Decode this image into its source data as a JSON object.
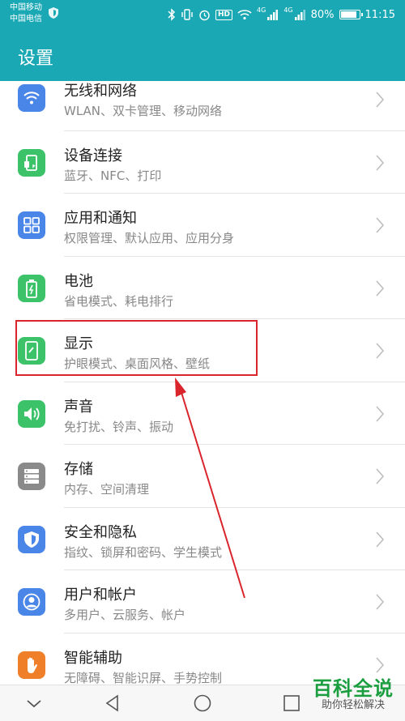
{
  "status_bar": {
    "carrier1": "中国移动",
    "carrier2": "中国电信",
    "battery": "80%",
    "time": "11:15",
    "hd_label": "HD",
    "network1": "4G",
    "network2": "4G"
  },
  "app_bar": {
    "title": "设置"
  },
  "settings": [
    {
      "title": "无线和网络",
      "subtitle": "WLAN、双卡管理、移动网络",
      "icon": "wifi-icon",
      "color": "#4a86e8"
    },
    {
      "title": "设备连接",
      "subtitle": "蓝牙、NFC、打印",
      "icon": "device-connection-icon",
      "color": "#3cc36a"
    },
    {
      "title": "应用和通知",
      "subtitle": "权限管理、默认应用、应用分身",
      "icon": "apps-icon",
      "color": "#4a86e8"
    },
    {
      "title": "电池",
      "subtitle": "省电模式、耗电排行",
      "icon": "battery-icon",
      "color": "#3cc36a"
    },
    {
      "title": "显示",
      "subtitle": "护眼模式、桌面风格、壁纸",
      "icon": "display-icon",
      "color": "#3cc36a"
    },
    {
      "title": "声音",
      "subtitle": "免打扰、铃声、振动",
      "icon": "sound-icon",
      "color": "#3cc36a"
    },
    {
      "title": "存储",
      "subtitle": "内存、空间清理",
      "icon": "storage-icon",
      "color": "#8a8a8a"
    },
    {
      "title": "安全和隐私",
      "subtitle": "指纹、锁屏和密码、学生模式",
      "icon": "security-shield-icon",
      "color": "#4a86e8"
    },
    {
      "title": "用户和帐户",
      "subtitle": "多用户、云服务、帐户",
      "icon": "user-icon",
      "color": "#4a86e8"
    },
    {
      "title": "智能辅助",
      "subtitle": "无障碍、智能识屏、手势控制",
      "icon": "hand-icon",
      "color": "#f07f2a"
    }
  ],
  "highlighted_item": "显示",
  "annotation_color": "#d9252b",
  "watermark": {
    "title": "百科全说",
    "subtitle": "助你轻松解决"
  },
  "nav_bar": {
    "buttons": [
      "collapse-down-icon",
      "back-icon",
      "home-icon",
      "recents-icon"
    ]
  }
}
